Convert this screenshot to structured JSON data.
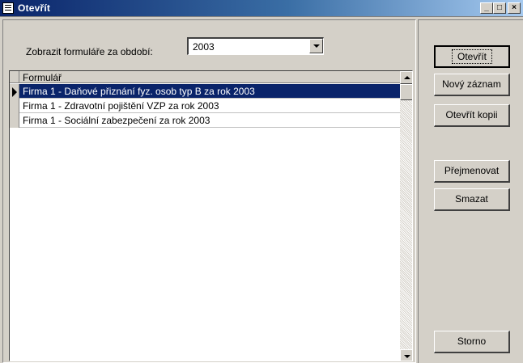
{
  "window": {
    "title": "Otevřít",
    "min_glyph": "_",
    "max_glyph": "□",
    "close_glyph": "×"
  },
  "filter": {
    "label": "Zobrazit formuláře za období:",
    "selected": "2003"
  },
  "grid": {
    "column_header": "Formulář",
    "rows": [
      "Firma 1 - Daňové přiznání fyz. osob typ B za rok 2003",
      "Firma 1 - Zdravotní pojištění VZP za rok 2003",
      "Firma 1 - Sociální zabezpečení za rok 2003"
    ],
    "selected_row": 0
  },
  "buttons": {
    "open": "Otevřít",
    "new_record": "Nový záznam",
    "open_copy": "Otevřít kopii",
    "rename": "Přejmenovat",
    "delete": "Smazat",
    "cancel": "Storno"
  },
  "colors": {
    "face": "#d4d0c8",
    "selection": "#0a246a",
    "title_start": "#0a246a",
    "title_end": "#a6caf0"
  },
  "icons": {
    "app": "form-window-icon",
    "row_pointer": "current-row-pointer-icon",
    "dropdown": "chevron-down-icon",
    "scroll_up": "arrow-up-icon",
    "scroll_down": "arrow-down-icon"
  }
}
